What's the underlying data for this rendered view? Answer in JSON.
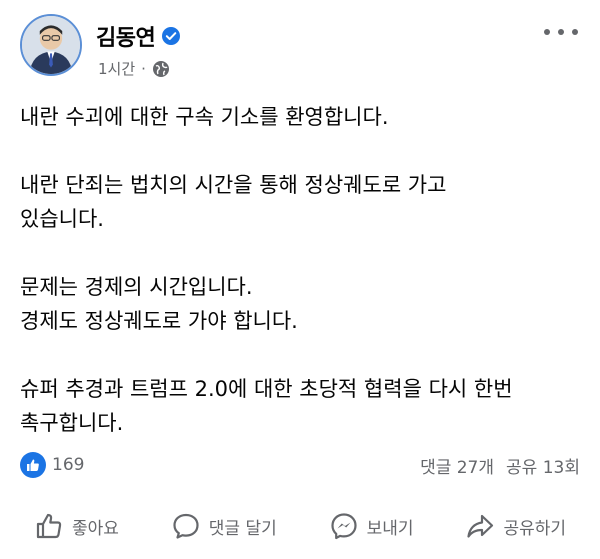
{
  "post": {
    "author": "김동연",
    "time": "1시간",
    "separator": "·",
    "paragraphs": [
      "내란 수괴에 대한 구속 기소를 환영합니다.",
      "내란 단죄는 법치의 시간을 통해 정상궤도로 가고\n있습니다.",
      "문제는 경제의 시간입니다.\n경제도 정상궤도로 가야 합니다.",
      "슈퍼 추경과 트럼프 2.0에 대한 초당적 협력을 다시 한번\n촉구합니다."
    ]
  },
  "stats": {
    "reaction_count": "169",
    "comments": "댓글 27개",
    "shares": "공유 13회"
  },
  "actions": {
    "like": "좋아요",
    "comment": "댓글 달기",
    "send": "보내기",
    "share": "공유하기"
  },
  "colors": {
    "accent": "#1b74e4",
    "secondary_text": "#65676b"
  },
  "icons": [
    "verified-badge-icon",
    "globe-icon",
    "more-options-icon",
    "thumbs-up-icon",
    "comment-bubble-icon",
    "messenger-icon",
    "share-arrow-icon"
  ]
}
